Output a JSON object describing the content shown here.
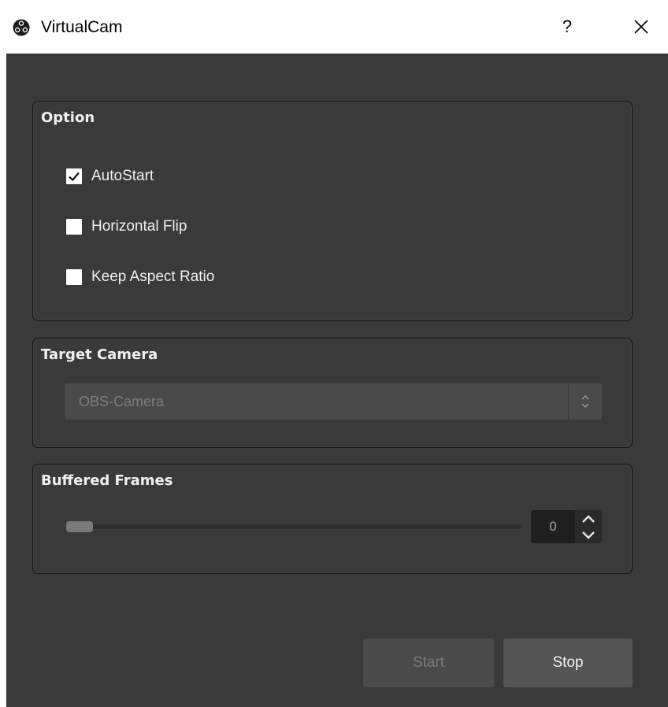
{
  "window": {
    "title": "VirtualCam",
    "app_icon": "obs-logo-icon",
    "help_label": "?",
    "close_icon": "close-icon"
  },
  "option_group": {
    "title": "Option",
    "checkboxes": [
      {
        "label": "AutoStart",
        "checked": true
      },
      {
        "label": "Horizontal Flip",
        "checked": false
      },
      {
        "label": "Keep Aspect Ratio",
        "checked": false
      }
    ]
  },
  "camera_group": {
    "title": "Target Camera",
    "selected": "OBS-Camera",
    "enabled": false
  },
  "frames_group": {
    "title": "Buffered Frames",
    "slider_fraction": 0,
    "value": "0"
  },
  "buttons": {
    "start_label": "Start",
    "start_enabled": false,
    "stop_label": "Stop"
  },
  "colors": {
    "panel_bg": "#3a3a3a",
    "text": "#f0f0f0",
    "disabled_text": "#7a7a7a"
  }
}
